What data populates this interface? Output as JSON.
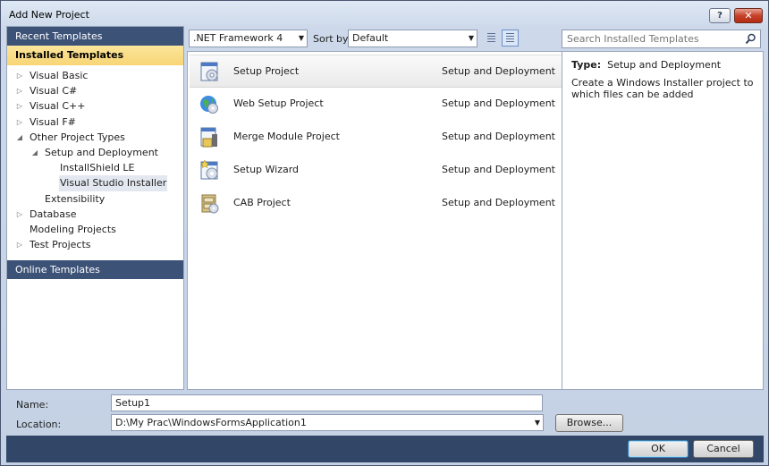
{
  "window": {
    "title": "Add New Project",
    "help_label": "?",
    "close_label": "✕"
  },
  "left": {
    "recent_label": "Recent Templates",
    "installed_label": "Installed Templates",
    "online_label": "Online Templates",
    "tree": [
      {
        "label": "Visual Basic",
        "arrow": "▷",
        "level": 0
      },
      {
        "label": "Visual C#",
        "arrow": "▷",
        "level": 0
      },
      {
        "label": "Visual C++",
        "arrow": "▷",
        "level": 0
      },
      {
        "label": "Visual F#",
        "arrow": "▷",
        "level": 0
      },
      {
        "label": "Other Project Types",
        "arrow": "◢",
        "level": 0
      },
      {
        "label": "Setup and Deployment",
        "arrow": "◢",
        "level": 1
      },
      {
        "label": "InstallShield LE",
        "arrow": "",
        "level": 2
      },
      {
        "label": "Visual Studio Installer",
        "arrow": "",
        "level": 2,
        "selected": true
      },
      {
        "label": "Extensibility",
        "arrow": "",
        "level": 1
      },
      {
        "label": "Database",
        "arrow": "▷",
        "level": 0
      },
      {
        "label": "Modeling Projects",
        "arrow": "",
        "level": 0
      },
      {
        "label": "Test Projects",
        "arrow": "▷",
        "level": 0
      }
    ]
  },
  "toolbar": {
    "framework": ".NET Framework 4",
    "sort_label": "Sort by:",
    "sort_value": "Default",
    "dropdown_glyph": "▼"
  },
  "search": {
    "placeholder": "Search Installed Templates"
  },
  "projects": [
    {
      "name": "Setup Project",
      "category": "Setup and Deployment",
      "icon": "setup-project-icon",
      "selected": true
    },
    {
      "name": "Web Setup Project",
      "category": "Setup and Deployment",
      "icon": "web-setup-icon"
    },
    {
      "name": "Merge Module Project",
      "category": "Setup and Deployment",
      "icon": "merge-module-icon"
    },
    {
      "name": "Setup Wizard",
      "category": "Setup and Deployment",
      "icon": "setup-wizard-icon"
    },
    {
      "name": "CAB Project",
      "category": "Setup and Deployment",
      "icon": "cab-project-icon"
    }
  ],
  "details": {
    "type_label": "Type:",
    "type_value": "Setup and Deployment",
    "description": "Create a Windows Installer project to which files can be added"
  },
  "form": {
    "name_label": "Name:",
    "name_value": "Setup1",
    "location_label": "Location:",
    "location_value": "D:\\My Prac\\WindowsFormsApplication1",
    "browse_label": "Browse...",
    "ok_label": "OK",
    "cancel_label": "Cancel"
  },
  "colors": {
    "header_dark": "#3d5277",
    "installed_highlight": "#f7d575",
    "bottom_bar": "#324668"
  }
}
